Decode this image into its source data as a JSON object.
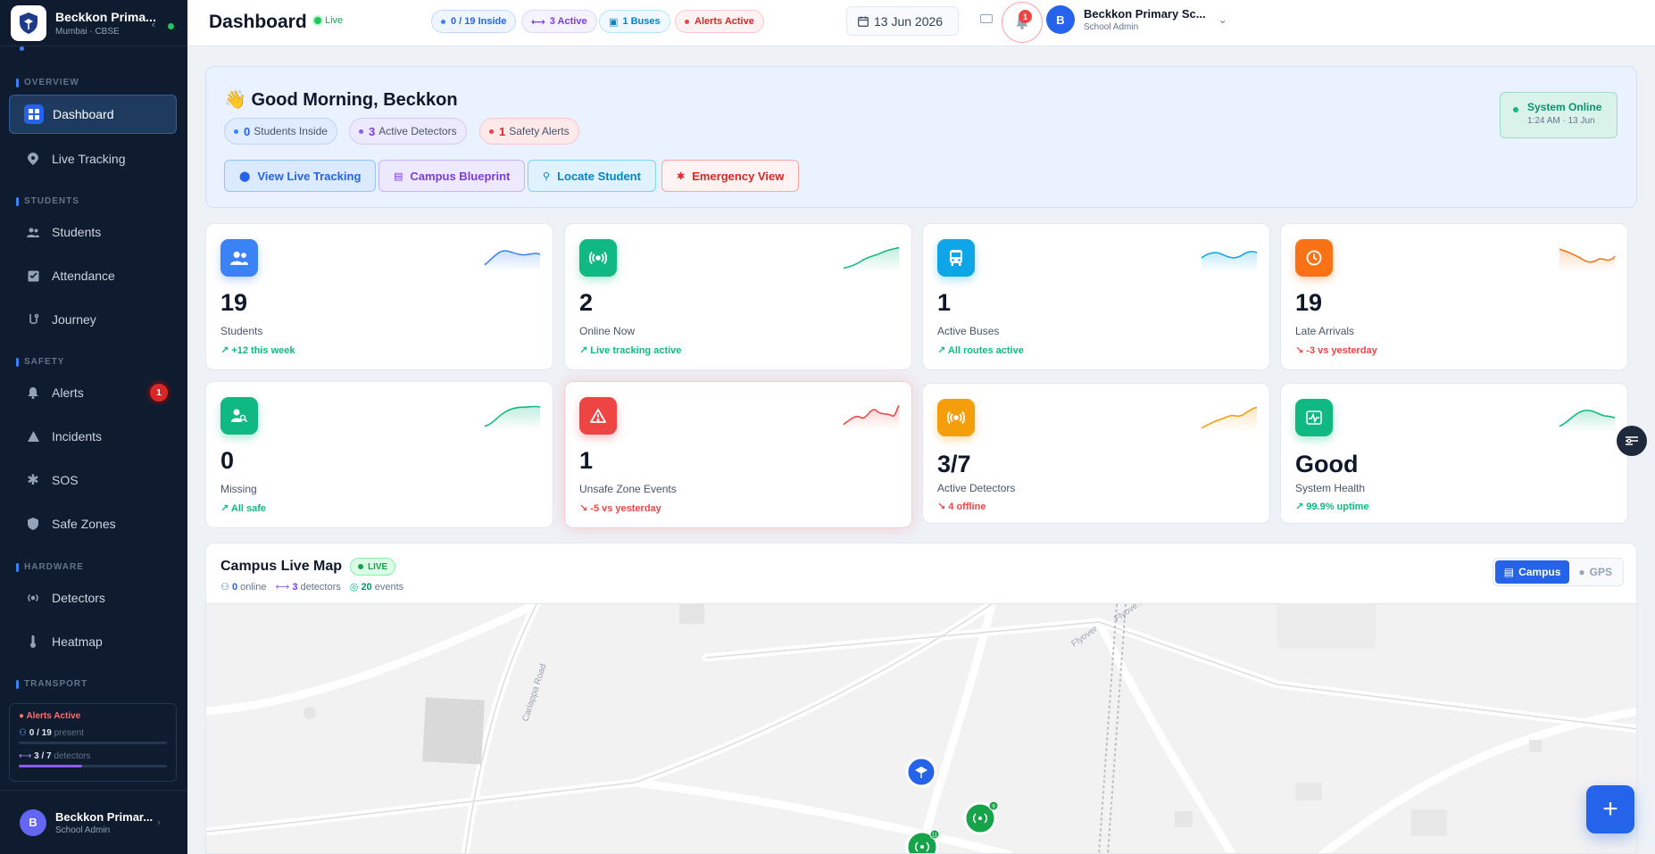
{
  "brand": {
    "name": "Beckkon Prima...",
    "sub": "Mumbai · CBSE"
  },
  "sidebar": {
    "sections": [
      "OVERVIEW",
      "STUDENTS",
      "SAFETY",
      "HARDWARE",
      "TRANSPORT"
    ],
    "items": [
      {
        "label": "Dashboard",
        "icon": "grid-icon"
      },
      {
        "label": "Live Tracking",
        "icon": "pin-icon"
      },
      {
        "label": "Students",
        "icon": "users-icon"
      },
      {
        "label": "Attendance",
        "icon": "checklist-icon"
      },
      {
        "label": "Journey",
        "icon": "route-icon"
      },
      {
        "label": "Alerts",
        "icon": "bell-icon",
        "badge": "1"
      },
      {
        "label": "Incidents",
        "icon": "warning-icon"
      },
      {
        "label": "SOS",
        "icon": "asterisk-icon"
      },
      {
        "label": "Safe Zones",
        "icon": "shield-icon"
      },
      {
        "label": "Detectors",
        "icon": "broadcast-icon"
      },
      {
        "label": "Heatmap",
        "icon": "thermometer-icon"
      }
    ],
    "status": {
      "alert": "Alerts Active",
      "present_value": "0 / 19",
      "present_label": "present",
      "detectors_value": "3 / 7",
      "detectors_label": "detectors",
      "detectors_fraction": 0.43
    },
    "user": {
      "initial": "B",
      "name": "Beckkon Primar...",
      "role": "School Admin"
    }
  },
  "topbar": {
    "title": "Dashboard",
    "live": "Live",
    "chips": [
      "0 / 19 Inside",
      "3 Active",
      "1 Buses",
      "Alerts Active"
    ],
    "date": "13 Jun 2026",
    "bell_badge": "1",
    "user": {
      "initial": "B",
      "name": "Beckkon Primary Sc...",
      "role": "School Admin"
    }
  },
  "welcome": {
    "emoji": "👋",
    "greeting": "Good Morning, Beckkon",
    "pills": [
      {
        "num": "0",
        "label": "Students Inside"
      },
      {
        "num": "3",
        "label": "Active Detectors"
      },
      {
        "num": "1",
        "label": "Safety Alerts"
      }
    ],
    "actions": [
      "View Live Tracking",
      "Campus Blueprint",
      "Locate Student",
      "Emergency View"
    ],
    "system": {
      "title": "System Online",
      "time": "1:24 AM · 13 Jun"
    }
  },
  "cards": [
    {
      "value": "19",
      "label": "Students",
      "trend": "+12 this week",
      "color": "#3b82f6",
      "trend_color": "#10b981",
      "icon": "users-icon"
    },
    {
      "value": "2",
      "label": "Online Now",
      "trend": "Live tracking active",
      "color": "#10b981",
      "trend_color": "#10b981",
      "icon": "broadcast-icon"
    },
    {
      "value": "1",
      "label": "Active Buses",
      "trend": "All routes active",
      "color": "#0ea5e9",
      "trend_color": "#10b981",
      "icon": "bus-icon"
    },
    {
      "value": "19",
      "label": "Late Arrivals",
      "trend": "-3 vs yesterday",
      "color": "#f97316",
      "trend_color": "#ef4444",
      "icon": "clock-icon"
    },
    {
      "value": "0",
      "label": "Missing",
      "trend": "All safe",
      "color": "#10b981",
      "trend_color": "#10b981",
      "icon": "user-search-icon"
    },
    {
      "value": "1",
      "label": "Unsafe Zone Events",
      "trend": "-5 vs yesterday",
      "color": "#ef4444",
      "trend_color": "#ef4444",
      "icon": "warning-icon"
    },
    {
      "value": "3/7",
      "label": "Active Detectors",
      "trend": "4 offline",
      "color": "#f59e0b",
      "trend_color": "#ef4444",
      "icon": "broadcast-icon"
    },
    {
      "value": "Good",
      "label": "System Health",
      "trend": "99.9% uptime",
      "color": "#10b981",
      "trend_color": "#10b981",
      "icon": "health-icon"
    }
  ],
  "map": {
    "title": "Campus Live Map",
    "live": "LIVE",
    "online": "0",
    "online_label": "online",
    "detectors": "3",
    "detectors_label": "detectors",
    "events": "20",
    "events_label": "events",
    "tabs": [
      "Campus",
      "GPS"
    ],
    "roads": [
      "Cariappa Road",
      "Flyover",
      "Flyove..."
    ],
    "marker_counts": [
      "11",
      "9"
    ]
  }
}
